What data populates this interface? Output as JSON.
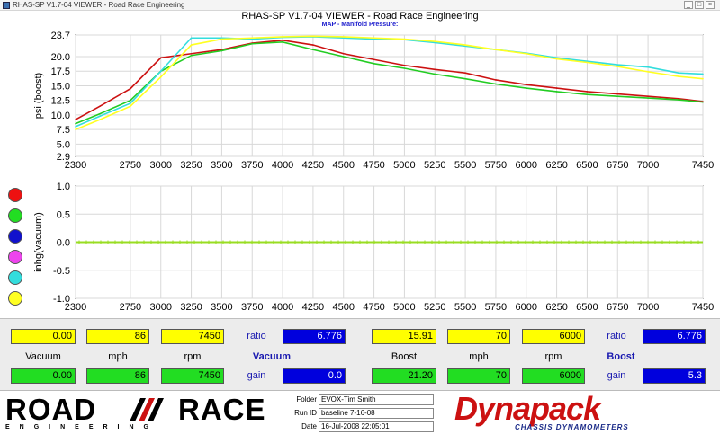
{
  "window": {
    "title": "RHAS-SP V1.7-04  VIEWER - Road Race Engineering"
  },
  "header": {
    "title": "RHAS-SP V1.7-04  VIEWER - Road Race Engineering",
    "subtitle": "MAP - Manifold Pressure:"
  },
  "legend": [
    {
      "color": "#ee1111"
    },
    {
      "color": "#22dd22"
    },
    {
      "color": "#1111cc"
    },
    {
      "color": "#ee44ee"
    },
    {
      "color": "#33dddd"
    },
    {
      "color": "#ffff22"
    }
  ],
  "chart_data": [
    {
      "type": "line",
      "title": "MAP - Manifold Pressure:",
      "xlabel": "",
      "ylabel": "psi (boost)",
      "xlim": [
        2300,
        7450
      ],
      "ylim": [
        2.9,
        23.7
      ],
      "x_ticks": [
        2300,
        2750,
        3000,
        3250,
        3500,
        3750,
        4000,
        4250,
        4500,
        4750,
        5000,
        5250,
        5500,
        5750,
        6000,
        6250,
        6500,
        6750,
        7000,
        7450
      ],
      "y_ticks": [
        2.9,
        5.0,
        7.5,
        10.0,
        12.5,
        15.0,
        17.5,
        20.0,
        23.7
      ],
      "grid": true,
      "series": [
        {
          "color": "#cc1111",
          "x": [
            2300,
            2500,
            2750,
            3000,
            3250,
            3500,
            3750,
            4000,
            4250,
            4500,
            4750,
            5000,
            5250,
            5500,
            5750,
            6000,
            6250,
            6500,
            6750,
            7000,
            7250,
            7450
          ],
          "values": [
            9.2,
            11.5,
            14.5,
            19.8,
            20.5,
            21.2,
            22.3,
            22.8,
            22.0,
            20.5,
            19.5,
            18.5,
            17.8,
            17.2,
            16.0,
            15.2,
            14.6,
            14.0,
            13.6,
            13.2,
            12.8,
            12.3
          ]
        },
        {
          "color": "#22cc22",
          "x": [
            2300,
            2500,
            2750,
            3000,
            3250,
            3500,
            3750,
            4000,
            4250,
            4500,
            4750,
            5000,
            5250,
            5500,
            5750,
            6000,
            6250,
            6500,
            6750,
            7000,
            7250,
            7450
          ],
          "values": [
            8.5,
            10.2,
            12.5,
            17.5,
            20.2,
            21.0,
            22.2,
            22.5,
            21.2,
            20.0,
            18.8,
            18.0,
            17.0,
            16.2,
            15.3,
            14.6,
            14.0,
            13.5,
            13.2,
            12.9,
            12.6,
            12.2
          ]
        },
        {
          "color": "#33dddd",
          "x": [
            2300,
            2500,
            2750,
            3000,
            3250,
            3500,
            3750,
            4000,
            4250,
            4500,
            4750,
            5000,
            5250,
            5500,
            5750,
            6000,
            6250,
            6500,
            6750,
            7000,
            7250,
            7450
          ],
          "values": [
            8.0,
            9.8,
            12.0,
            17.5,
            23.2,
            23.2,
            23.0,
            23.3,
            23.4,
            23.2,
            23.0,
            22.9,
            22.4,
            21.8,
            21.2,
            20.6,
            19.8,
            19.2,
            18.6,
            18.2,
            17.2,
            17.0
          ]
        },
        {
          "color": "#ffff22",
          "x": [
            2300,
            2500,
            2750,
            3000,
            3250,
            3500,
            3750,
            4000,
            4250,
            4500,
            4750,
            5000,
            5250,
            5500,
            5750,
            6000,
            6250,
            6500,
            6750,
            7000,
            7250,
            7450
          ],
          "values": [
            7.5,
            9.2,
            11.5,
            16.5,
            22.0,
            23.0,
            23.2,
            23.4,
            23.5,
            23.4,
            23.2,
            23.0,
            22.6,
            22.0,
            21.2,
            20.5,
            19.6,
            19.0,
            18.3,
            17.4,
            16.6,
            16.2
          ]
        }
      ]
    },
    {
      "type": "line",
      "title": "",
      "xlabel": "",
      "ylabel": "inhg(vacuum)",
      "xlim": [
        2300,
        7450
      ],
      "ylim": [
        -1.0,
        1.0
      ],
      "x_ticks": [
        2300,
        2750,
        3000,
        3250,
        3500,
        3750,
        4000,
        4250,
        4500,
        4750,
        5000,
        5250,
        5500,
        5750,
        6000,
        6250,
        6500,
        6750,
        7000,
        7450
      ],
      "y_ticks": [
        "1.0",
        "0.5",
        "0.0",
        "-0.5",
        "-1.0"
      ],
      "grid": true,
      "series": [
        {
          "color": "#99dd22",
          "x": [
            2300,
            7450
          ],
          "values": [
            0.0,
            0.0
          ]
        }
      ]
    }
  ],
  "panel": {
    "left": {
      "top": {
        "vacuum": "0.00",
        "mph": "86",
        "rpm": "7450",
        "ratio_label": "ratio",
        "ratio": "6.776"
      },
      "labels": {
        "vacuum": "Vacuum",
        "mph": "mph",
        "rpm": "rpm",
        "section": "Vacuum"
      },
      "bottom": {
        "vacuum": "0.00",
        "mph": "86",
        "rpm": "7450",
        "gain_label": "gain",
        "gain": "0.0"
      }
    },
    "right": {
      "top": {
        "boost": "15.91",
        "mph": "70",
        "rpm": "6000",
        "ratio_label": "ratio",
        "ratio": "6.776"
      },
      "labels": {
        "boost": "Boost",
        "mph": "mph",
        "rpm": "rpm",
        "section": "Boost"
      },
      "bottom": {
        "boost": "21.20",
        "mph": "70",
        "rpm": "6000",
        "gain_label": "gain",
        "gain": "5.3"
      }
    }
  },
  "footer": {
    "logo_left": "ROAD",
    "logo_right": "RACE",
    "logo_sub": "ENGINEERING",
    "folder_label": "Folder",
    "folder": "EVOX-Tim Smith",
    "runid_label": "Run ID",
    "runid": "baseline 7-16-08",
    "date_label": "Date",
    "date": "16-Jul-2008  22:05:01",
    "brand": "Dynapack",
    "brand_sub": "CHASSIS DYNAMOMETERS"
  }
}
